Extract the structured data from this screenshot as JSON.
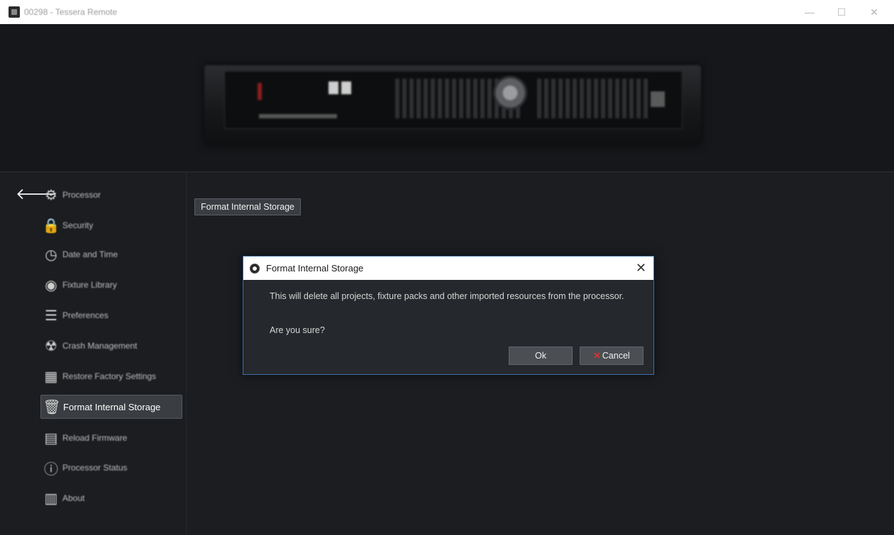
{
  "window": {
    "title": "00298 - Tessera Remote",
    "minimize_glyph": "—",
    "maximize_glyph": "☐",
    "close_glyph": "✕"
  },
  "sidebar": {
    "back_glyph": "🡐",
    "items": [
      {
        "label": "Processor",
        "icon": "gear-icon",
        "glyph": "⚙"
      },
      {
        "label": "Security",
        "icon": "lock-icon",
        "glyph": "🔒"
      },
      {
        "label": "Date and Time",
        "icon": "clock-icon",
        "glyph": "◷"
      },
      {
        "label": "Fixture Library",
        "icon": "fixture-icon",
        "glyph": "◉"
      },
      {
        "label": "Preferences",
        "icon": "list-icon",
        "glyph": "☰"
      },
      {
        "label": "Crash Management",
        "icon": "radiation-icon",
        "glyph": "☢"
      },
      {
        "label": "Restore Factory Settings",
        "icon": "factory-icon",
        "glyph": "▦"
      },
      {
        "label": "Format Internal Storage",
        "icon": "trash-icon",
        "glyph": "🗑"
      },
      {
        "label": "Reload Firmware",
        "icon": "firmware-icon",
        "glyph": "▤"
      },
      {
        "label": "Processor Status",
        "icon": "info-icon",
        "glyph": "ⓘ"
      },
      {
        "label": "About",
        "icon": "book-icon",
        "glyph": "▥"
      }
    ],
    "active_index": 7
  },
  "main": {
    "section_button": "Format Internal Storage"
  },
  "dialog": {
    "title": "Format Internal Storage",
    "close_glyph": "✕",
    "message": "This will delete all projects, fixture packs and other imported resources from the processor.",
    "question": "Are you sure?",
    "ok_label": "Ok",
    "cancel_icon": "✕",
    "cancel_label": "Cancel"
  },
  "colors": {
    "background": "#1b1d20",
    "accent_border": "#3d6ea6",
    "cancel_icon": "#e0322c"
  }
}
